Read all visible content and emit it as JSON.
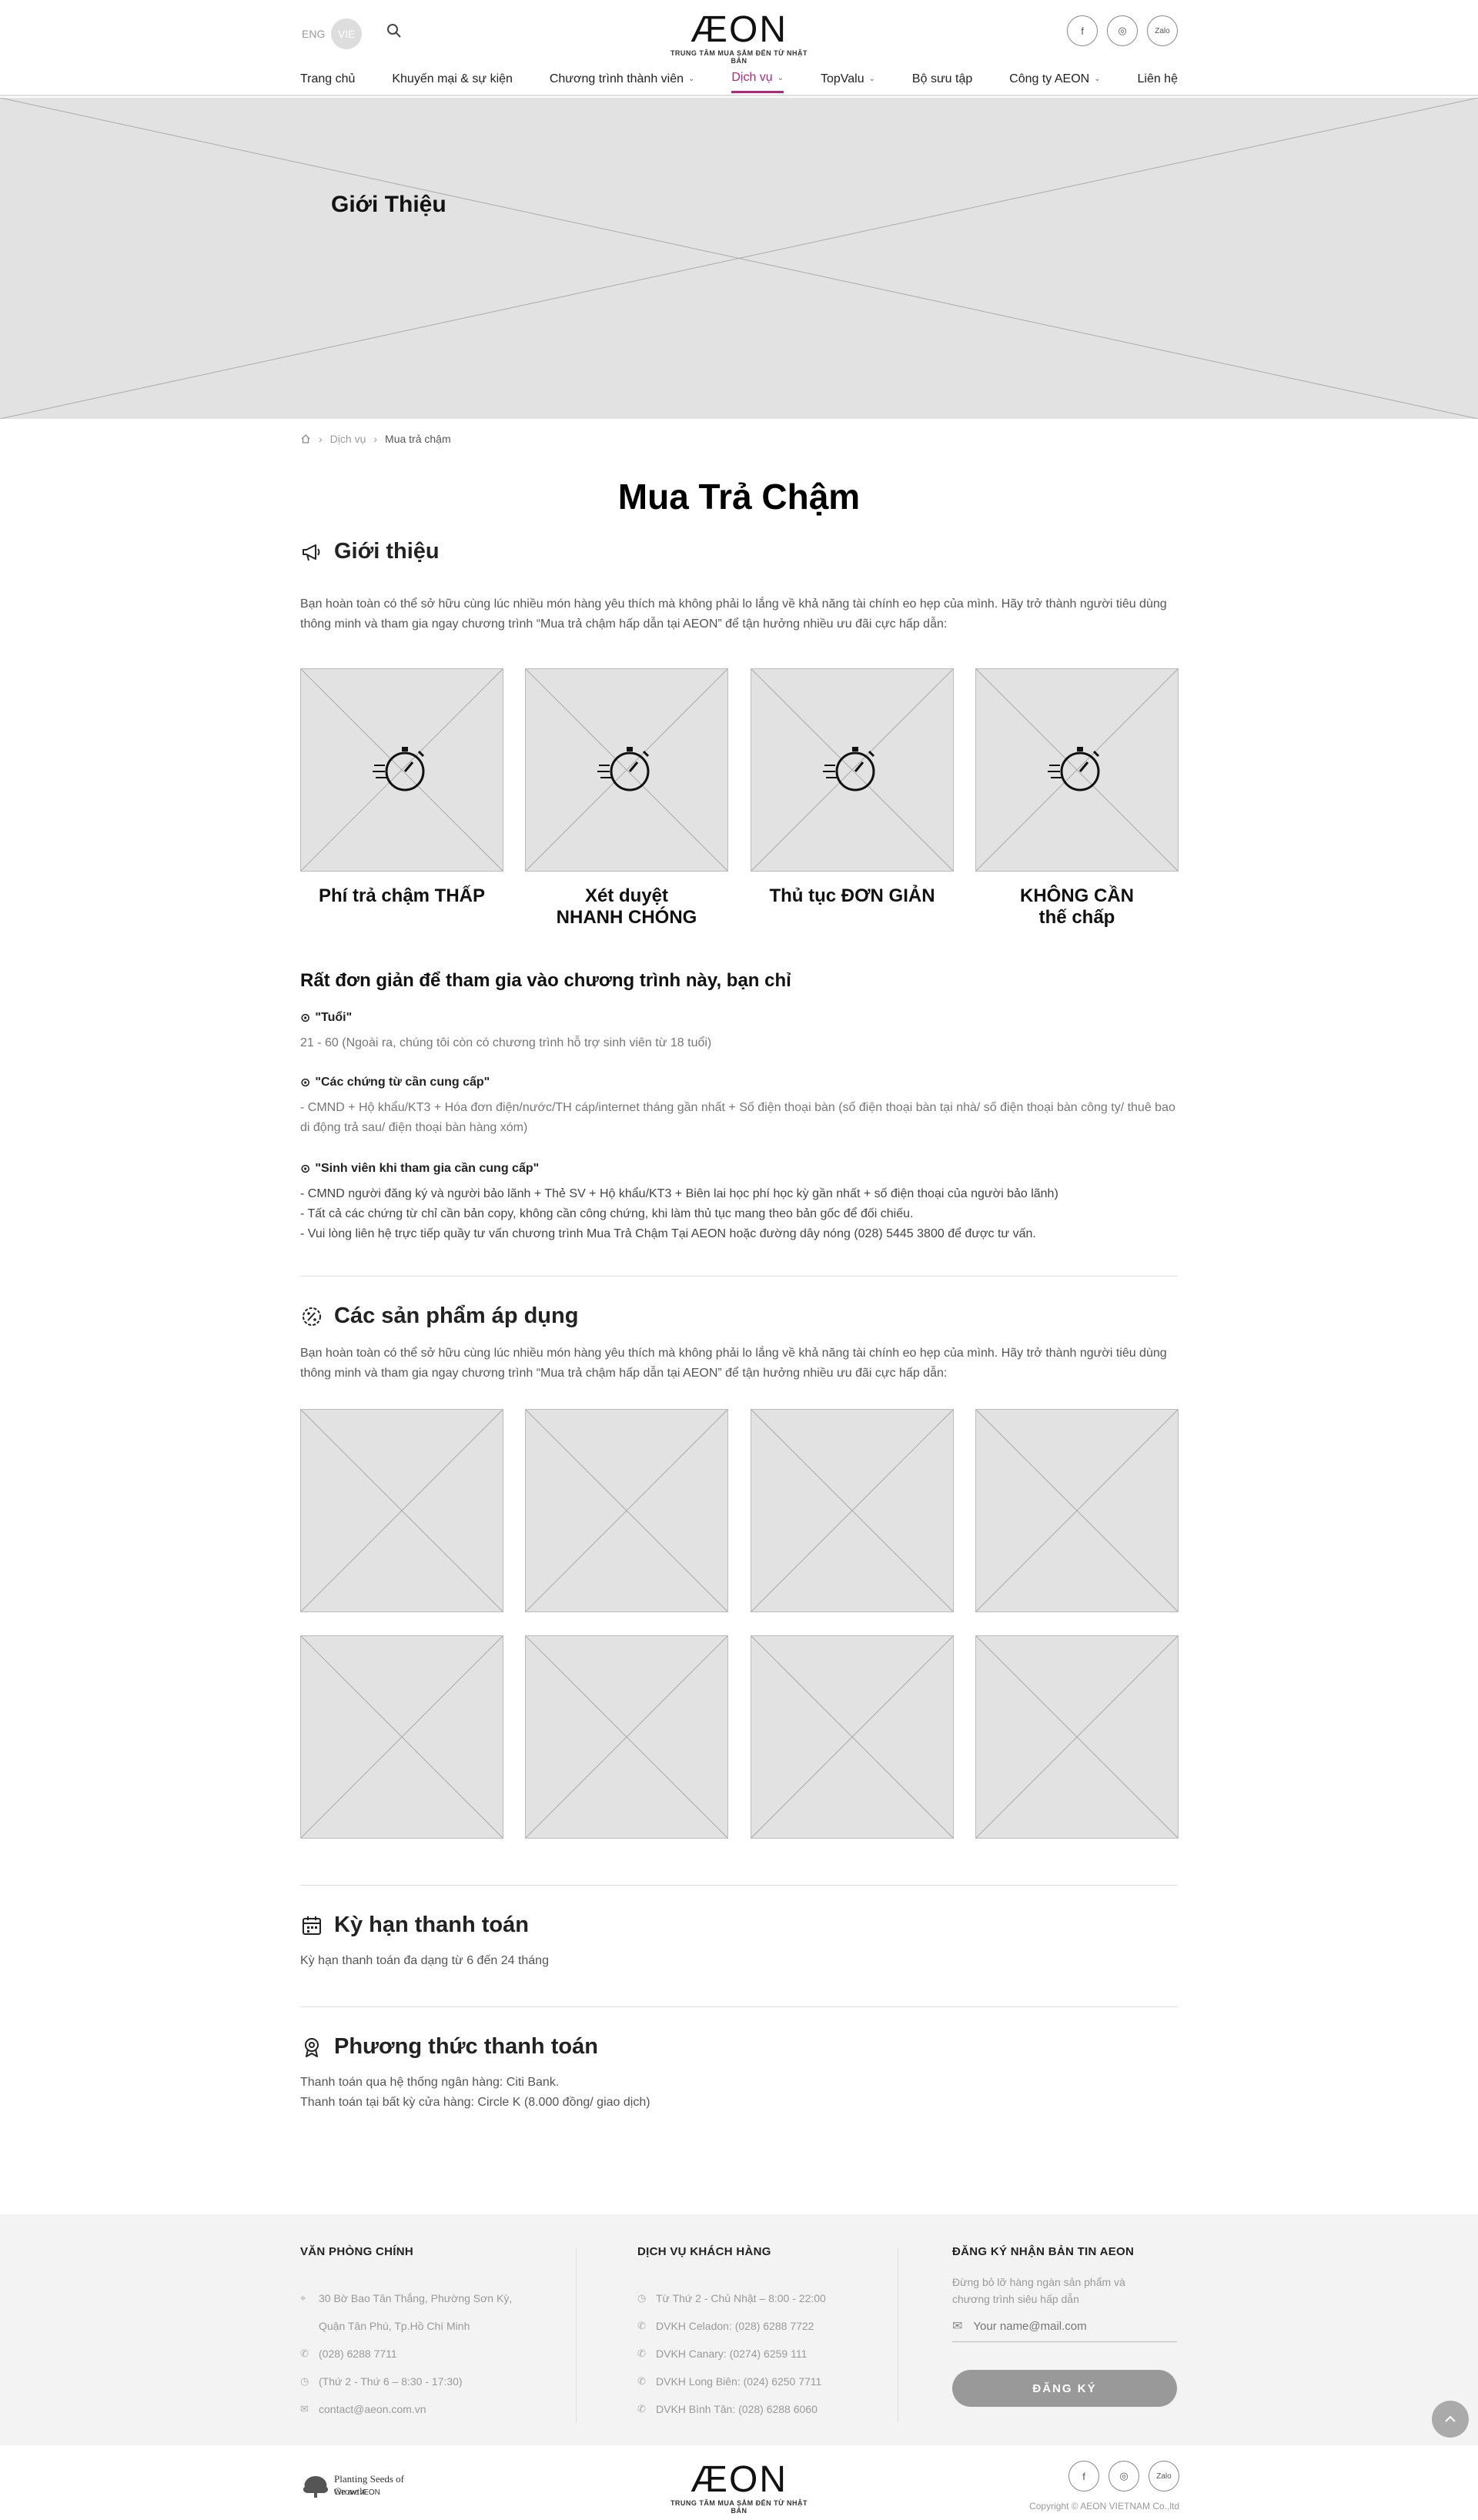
{
  "header": {
    "lang_eng": "ENG",
    "lang_vie": "VIE",
    "logo_word": "ÆON",
    "logo_tagline": "TRUNG TÂM MUA SẮM ĐẾN TỪ NHẬT BẢN",
    "social_labels": [
      "f",
      "◎",
      "Zalo"
    ],
    "nav": [
      {
        "label": "Trang chủ",
        "has_dropdown": false
      },
      {
        "label": "Khuyến mại & sự kiện",
        "has_dropdown": false
      },
      {
        "label": "Chương trình thành viên",
        "has_dropdown": true
      },
      {
        "label": "Dịch vụ",
        "has_dropdown": true,
        "active": true
      },
      {
        "label": "TopValu",
        "has_dropdown": true
      },
      {
        "label": "Bộ sưu tập",
        "has_dropdown": false
      },
      {
        "label": "Công ty AEON",
        "has_dropdown": true
      },
      {
        "label": "Liên hệ",
        "has_dropdown": false
      }
    ],
    "accent_color": "#b5267a"
  },
  "hero": {
    "title": "Giới Thiệu"
  },
  "breadcrumb": {
    "home_icon": "home-icon",
    "items": [
      "Dịch vụ",
      "Mua  trả chậm"
    ]
  },
  "page_title": "Mua Trả Chậm",
  "intro": {
    "heading": "Giới thiệu",
    "text": "Bạn hoàn toàn có thể sở hữu cùng lúc nhiều món hàng yêu thích mà không phải lo lắng về khả năng tài chính eo hẹp của mình. Hãy trở thành người tiêu dùng thông minh và tham gia ngay chương trình “Mua trả chậm hấp dẫn tại AEON” để tận hưởng nhiều ưu đãi cực hấp dẫn:"
  },
  "features": [
    {
      "line1": "Phí trả chậm THẤP",
      "line2": ""
    },
    {
      "line1": "Xét duyệt",
      "line2": "NHANH CHÓNG"
    },
    {
      "line1": "Thủ tục ĐƠN GIẢN",
      "line2": ""
    },
    {
      "line1": "KHÔNG CẦN",
      "line2": "thế chấp"
    }
  ],
  "requirements": {
    "title": "Rất đơn giản để tham gia vào chương trình này, bạn chỉ",
    "age_label": "\"Tuổi\"",
    "age_text": "21 - 60 (Ngoài ra, chúng tôi còn có chương trình hỗ trợ sinh viên từ 18 tuổi)",
    "docs_label": "\"Các chứng từ cần cung cấp\"",
    "docs_text": "- CMND + Hộ khẩu/KT3 + Hóa đơn điện/nước/TH cáp/internet tháng gần nhất + Số điện thoại bàn (số điện thoại bàn tại nhà/ số điện thoại bàn công ty/ thuê bao di động trả sau/ điện thoại bàn hàng xóm)",
    "student_label": "\"Sinh viên khi tham gia cần cung cấp\"",
    "student_lines": [
      "- CMND người đăng ký và người bảo lãnh + Thẻ SV + Hộ khẩu/KT3 + Biên lai học phí học kỳ gần nhất + số điện thoại của người bảo lãnh)",
      "- Tất cả các chứng từ chỉ cần bản copy, không cần công chứng, khi làm thủ tục mang theo bản gốc để đối chiếu.",
      "- Vui lòng liên hệ trực tiếp quầy tư vấn chương trình Mua Trả Chậm Tại AEON hoặc đường dây nóng (028) 5445 3800 để được tư vấn."
    ]
  },
  "products": {
    "heading": "Các sản phẩm áp dụng",
    "text": "Bạn hoàn toàn có thể sở hữu cùng lúc nhiều món hàng yêu thích mà không phải lo lắng về khả năng tài chính eo hẹp của mình. Hãy trở thành người tiêu dùng thông minh và tham gia ngay chương trình “Mua trả chậm hấp dẫn tại AEON” để tận hưởng nhiều ưu đãi cực hấp dẫn:"
  },
  "term": {
    "heading": "Kỳ hạn thanh toán",
    "text": "Kỳ hạn thanh toán đa dạng từ 6 đến 24 tháng"
  },
  "payment": {
    "heading": "Phương thức thanh toán",
    "lines": [
      "Thanh toán qua hệ thống ngân hàng: Citi Bank.",
      "Thanh toán tại bất kỳ cửa hàng: Circle K (8.000 đồng/ giao dịch)"
    ]
  },
  "footer": {
    "office": {
      "title": "VĂN PHÒNG CHÍNH",
      "address_1": "30 Bờ Bao Tân Thắng, Phường Sơn Kỳ,",
      "address_2": "Quận Tân Phú, Tp.Hồ Chí Minh",
      "phone": "(028) 6288 7711",
      "hours": "(Thứ 2 - Thứ 6 – 8:30 - 17:30)",
      "email": "contact@aeon.com.vn"
    },
    "service": {
      "title": "DỊCH VỤ KHÁCH HÀNG",
      "lines": [
        "Từ Thứ 2 - Chủ Nhật – 8:00 - 22:00",
        "DVKH Celadon: (028) 6288 7722",
        "DVKH Canary: (0274) 6259 111",
        "DVKH Long Biên: (024) 6250 7711",
        "DVKH Bình Tân: (028) 6288 6060"
      ]
    },
    "newsletter": {
      "title": "ĐĂNG KÝ NHẬN BẢN TIN AEON",
      "desc": "Đừng bỏ lỡ hàng ngàn sản phẩm và chương trình siêu hấp dẫn",
      "placeholder": "Your name@mail.com",
      "button": "ĐĂNG KÝ"
    }
  },
  "bottom": {
    "planting_line1": "Planting Seeds of Growth",
    "planting_line2": "We are ÆON",
    "copyright": "Copyright © AEON VIETNAM Co.,ltd"
  }
}
